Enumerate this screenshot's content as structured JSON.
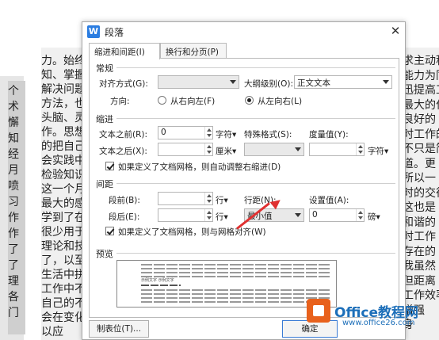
{
  "background_doc": {
    "left_col": [
      "个",
      "术",
      "懈",
      "知",
      "经",
      "月",
      "喷",
      "习",
      "作",
      "作",
      "了",
      "了",
      "理",
      "各",
      "门"
    ],
    "mid_col": [
      "力。始终",
      "知、掌握",
      "解决问题",
      "方法，也",
      "头脑、灵",
      "作。思想",
      "的把自己",
      "会实践中",
      "检验知识",
      "这一个月",
      "最大的感",
      "学到了在",
      "很少用于",
      "理论和技",
      "了，以至",
      "生活中拼",
      "工作中不",
      "自己的不",
      "会在变化",
      "以应"
    ],
    "right_col": [
      "求主动积",
      "能力为同",
      "迅提高工",
      "最大的付",
      "良好的",
      "时工作的",
      "不只是简",
      "道。更",
      "所以一",
      "时的交往",
      "这也是",
      "和谐的",
      "时工作",
      "存在的",
      "我虽然",
      "但距离",
      "工作效率",
      "增强",
      "身"
    ]
  },
  "dialog": {
    "title": "段落",
    "close_glyph": "✕",
    "tabs": [
      "缩进和间距(I)",
      "换行和分页(P)"
    ],
    "general": {
      "section_label": "常规",
      "alignment_label": "对齐方式(G):",
      "alignment_value": "",
      "outline_label": "大纲级别(O):",
      "outline_value": "正文文本",
      "direction_label": "方向:",
      "rtl_label": "从右向左(F)",
      "ltr_label": "从左向右(L)"
    },
    "indent": {
      "section_label": "缩进",
      "before_label": "文本之前(R):",
      "before_value": "0",
      "before_unit": "字符▾",
      "after_label": "文本之后(X):",
      "after_value": "",
      "after_unit": "厘米▾",
      "special_label": "特殊格式(S):",
      "special_value": "",
      "measure_label": "度量值(Y):",
      "measure_value": "",
      "measure_unit": "字符▾",
      "grid_check_label": "如果定义了文档网格，则自动调整右缩进(D)"
    },
    "spacing": {
      "section_label": "间距",
      "before_label": "段前(B):",
      "before_value": "",
      "before_unit": "行▾",
      "after_label": "段后(E):",
      "after_value": "",
      "after_unit": "行▾",
      "line_label": "行距(N):",
      "line_value": "最小值",
      "setting_label": "设置值(A):",
      "setting_value": "0",
      "setting_unit": "磅▾",
      "grid_check_label": "如果定义了文档网格，则与网格对齐(W)"
    },
    "preview": {
      "section_label": "预览",
      "sample_text": "示例文字 示例文字"
    },
    "buttons": {
      "tabs_button": "制表位(T)...",
      "ok_button": "确定"
    }
  },
  "watermark": {
    "title": "Office教程网",
    "url": "www.office26.com"
  },
  "colors": {
    "accent": "#2b7de1",
    "arrow": "#e03030",
    "logo_orange": "#e8611c",
    "logo_blue": "#1d6fb9"
  }
}
